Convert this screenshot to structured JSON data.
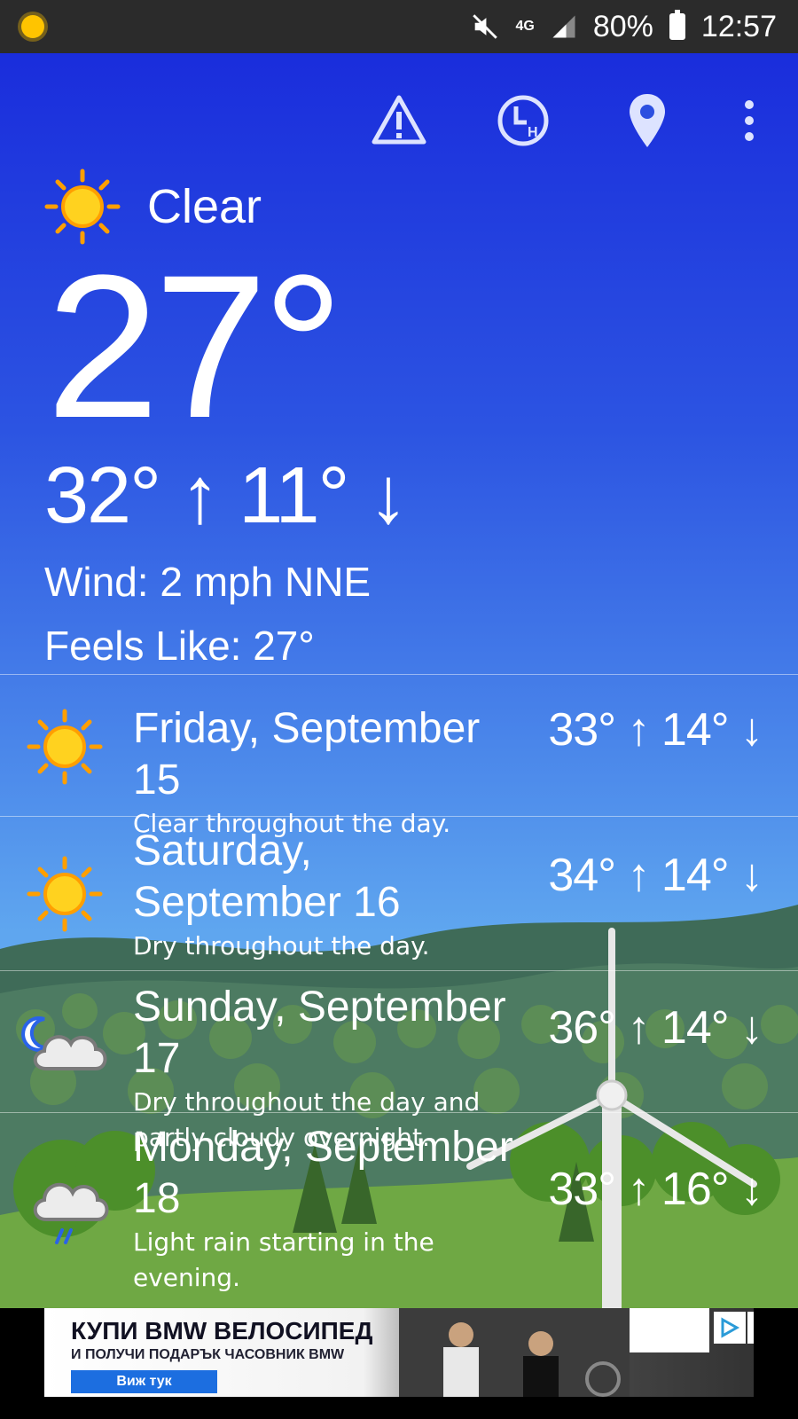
{
  "status_bar": {
    "network": "4G",
    "battery": "80%",
    "time": "12:57"
  },
  "toolbar": {
    "icons": [
      "warning-icon",
      "hourly-clock-icon",
      "location-pin-icon",
      "more-vert-icon"
    ]
  },
  "current": {
    "condition": "Clear",
    "temperature": "27°",
    "high_low": "32° ↑ 11° ↓",
    "wind": "Wind: 2 mph NNE",
    "feels_like": "Feels Like: 27°"
  },
  "forecast": [
    {
      "date": "Friday, September 15",
      "summary": "Clear throughout the day.",
      "temps": "33° ↑ 14° ↓",
      "icon": "sun-icon"
    },
    {
      "date": "Saturday, September 16",
      "summary": "Dry throughout the day.",
      "temps": "34° ↑ 14° ↓",
      "icon": "sun-icon"
    },
    {
      "date": "Sunday, September 17",
      "summary": "Dry throughout the day and partly cloudy overnight.",
      "temps": "36° ↑ 14° ↓",
      "icon": "partly-cloudy-night-icon"
    },
    {
      "date": "Monday, September 18",
      "summary": "Light rain starting in the evening.",
      "temps": "33° ↑ 16° ↓",
      "icon": "rain-cloud-icon"
    }
  ],
  "ad": {
    "headline": "КУПИ BMW ВЕЛОСИПЕД",
    "subline": "И ПОЛУЧИ ПОДАРЪК ЧАСОВНИК BMW",
    "cta": "Виж тук"
  },
  "colors": {
    "sky_top": "#1a2ddc",
    "sky_bottom": "#68b2f2",
    "sun": "#ffc400",
    "sun_rays": "#ff9f00",
    "status_bar": "#2b2b2b"
  }
}
